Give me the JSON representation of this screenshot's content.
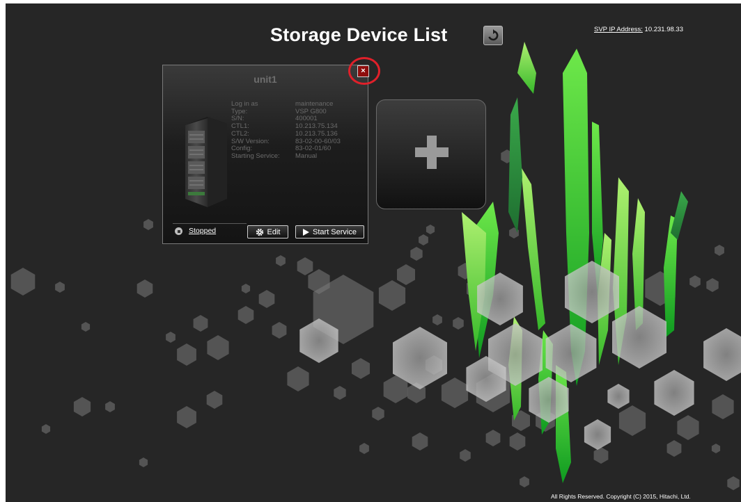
{
  "header": {
    "title": "Storage Device List",
    "svp_label": "SVP IP Address:",
    "svp_value": "10.231.98.33"
  },
  "device_card": {
    "name": "unit1",
    "fields": [
      {
        "label": "Log in as",
        "value": "maintenance"
      },
      {
        "label": "Type:",
        "value": "VSP G800"
      },
      {
        "label": "S/N:",
        "value": "400001"
      },
      {
        "label": "CTL1:",
        "value": "10.213.75.134"
      },
      {
        "label": "CTL2:",
        "value": "10.213.75.136"
      },
      {
        "label": "S/W Version:",
        "value": "83-02-00-60/03"
      },
      {
        "label": "Config:",
        "value": "83-02-01/60"
      },
      {
        "label": "Starting Service:",
        "value": "Manual"
      }
    ],
    "status": "Stopped",
    "edit_label": "Edit",
    "start_label": "Start Service",
    "close_symbol": "×"
  },
  "add_tile": {
    "icon": "plus-icon"
  },
  "footer": {
    "copyright": "All Rights Reserved. Copyright (C) 2015, Hitachi, Ltd."
  },
  "colors": {
    "background": "#262626",
    "accent_green": "#39c82a",
    "close_red": "#8e0d0d",
    "highlight_circle": "#e0202a"
  }
}
